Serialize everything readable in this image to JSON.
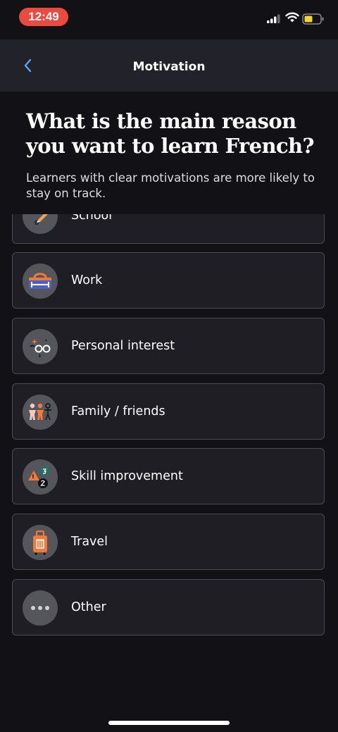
{
  "status_bar": {
    "time": "12:49",
    "icons": [
      "signal-icon",
      "wifi-icon",
      "battery-icon"
    ],
    "time_pill_color": "#eb4a3f",
    "battery_color": "#f5d531"
  },
  "nav": {
    "title": "Motivation",
    "back_icon": "chevron-left-icon",
    "back_icon_color": "#5aa6f0"
  },
  "header": {
    "question": "What is the main reason you want to learn French?",
    "subtitle": "Learners with clear motivations are more likely to stay on track."
  },
  "options": [
    {
      "label": "School",
      "icon": "pencil-icon"
    },
    {
      "label": "Work",
      "icon": "briefcase-icon"
    },
    {
      "label": "Personal interest",
      "icon": "glasses-icon"
    },
    {
      "label": "Family / friends",
      "icon": "people-icon"
    },
    {
      "label": "Skill improvement",
      "icon": "number-blocks-icon"
    },
    {
      "label": "Travel",
      "icon": "suitcase-icon"
    },
    {
      "label": "Other",
      "icon": "more-dots-icon"
    }
  ],
  "colors": {
    "background": "#111116",
    "nav_background": "#22222a",
    "option_background": "#1e1e24",
    "option_border": "#4a4a52",
    "icon_circle": "#55555c"
  }
}
